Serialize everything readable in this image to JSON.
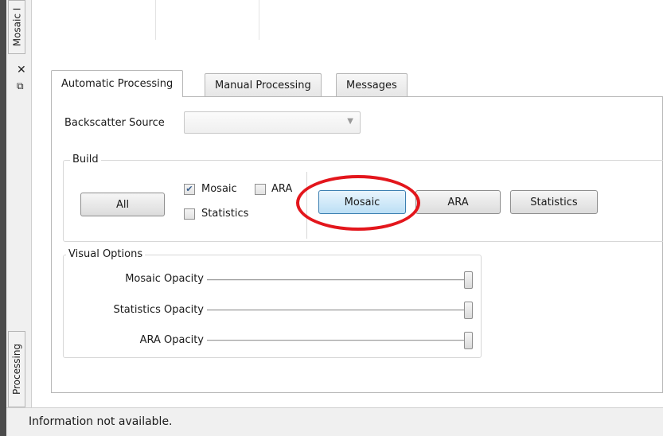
{
  "side_panel": {
    "top_tab_label": "Mosaic I",
    "bottom_tab_label": "Processing",
    "close_icon": "close-icon",
    "float_icon": "float-window-icon"
  },
  "tabs": [
    {
      "label": "Automatic Processing",
      "active": true
    },
    {
      "label": "Manual Processing",
      "active": false
    },
    {
      "label": "Messages",
      "active": false
    }
  ],
  "backscatter": {
    "label": "Backscatter Source",
    "value": ""
  },
  "build": {
    "legend": "Build",
    "all_label": "All",
    "checkboxes": {
      "mosaic": {
        "label": "Mosaic",
        "checked": true
      },
      "ara": {
        "label": "ARA",
        "checked": false
      },
      "statistics": {
        "label": "Statistics",
        "checked": false
      }
    },
    "buttons": {
      "mosaic": "Mosaic",
      "ara": "ARA",
      "statistics": "Statistics"
    }
  },
  "visual_options": {
    "legend": "Visual Options",
    "sliders": [
      {
        "label": "Mosaic Opacity",
        "value": 1.0
      },
      {
        "label": "Statistics Opacity",
        "value": 1.0
      },
      {
        "label": "ARA Opacity",
        "value": 1.0
      }
    ]
  },
  "status": {
    "text": "Information not available."
  },
  "colors": {
    "highlight_circle": "#e3161c",
    "highlighted_button": "#bcdff5"
  }
}
